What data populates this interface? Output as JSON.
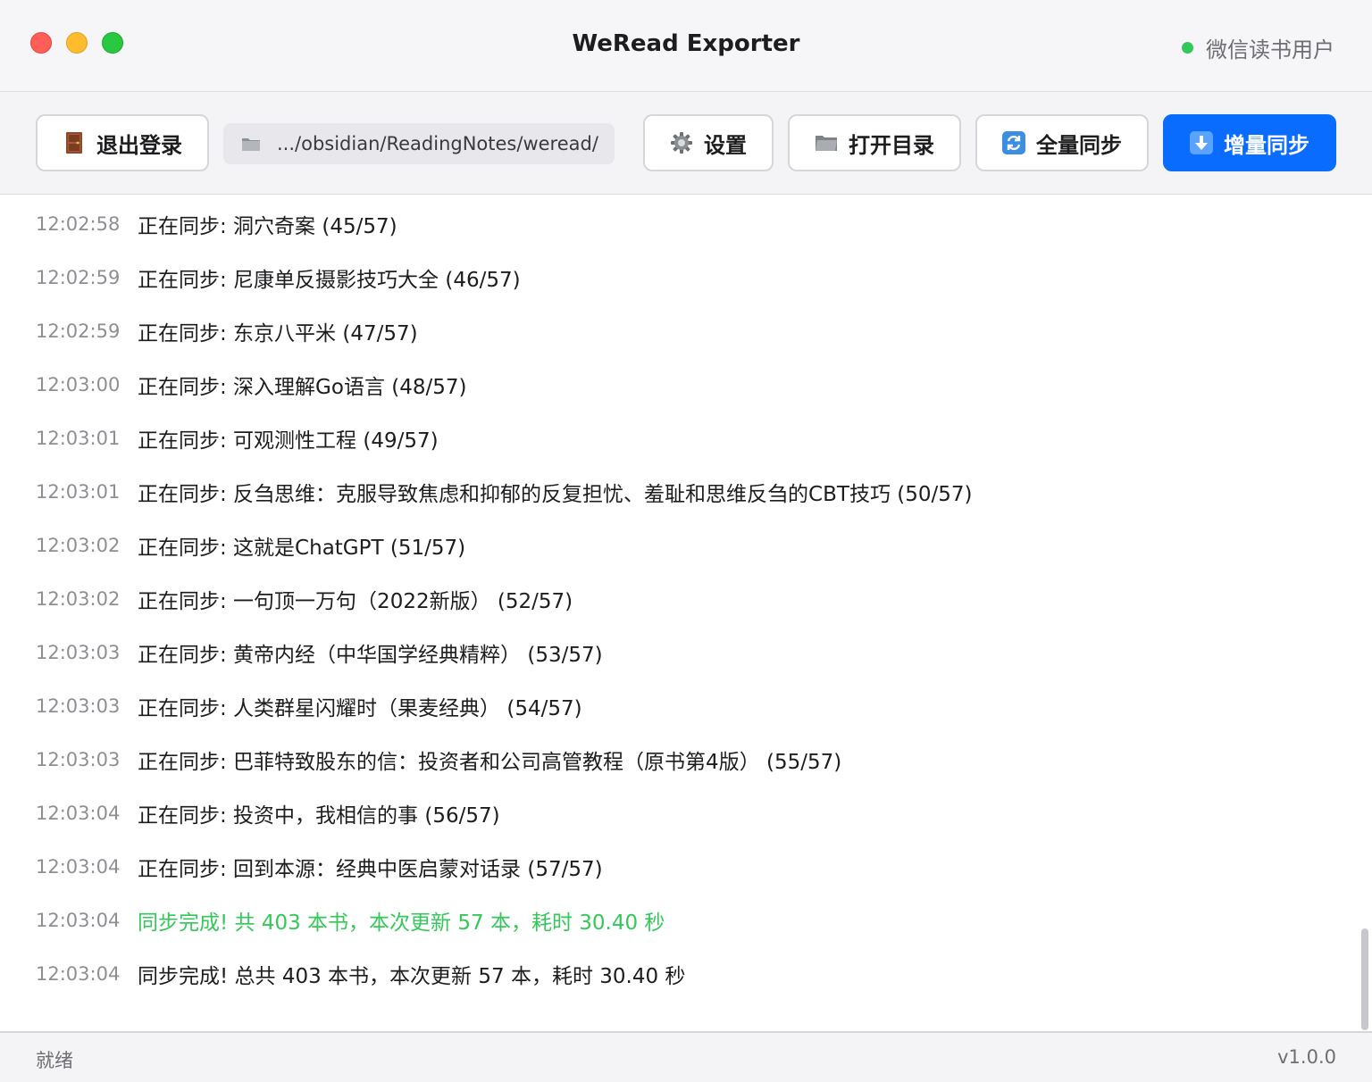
{
  "window": {
    "title": "WeRead Exporter",
    "user_label": "微信读书用户",
    "status_color": "#34c759"
  },
  "toolbar": {
    "logout_label": "退出登录",
    "logout_icon": "door-icon",
    "path_value": ".../obsidian/ReadingNotes/weread/",
    "path_icon": "folder-icon",
    "settings_label": "设置",
    "settings_icon": "gear-icon",
    "open_dir_label": "打开目录",
    "open_dir_icon": "folder-icon",
    "full_sync_label": "全量同步",
    "full_sync_icon": "refresh-icon",
    "incremental_sync_label": "增量同步",
    "incremental_sync_icon": "download-arrow-icon",
    "accent_color": "#0a6cff"
  },
  "log": {
    "entries": [
      {
        "time": "12:02:58",
        "message": "正在同步: 洞穴奇案 (45/57)",
        "type": "normal"
      },
      {
        "time": "12:02:59",
        "message": "正在同步: 尼康单反摄影技巧大全 (46/57)",
        "type": "normal"
      },
      {
        "time": "12:02:59",
        "message": "正在同步: 东京八平米 (47/57)",
        "type": "normal"
      },
      {
        "time": "12:03:00",
        "message": "正在同步: 深入理解Go语言 (48/57)",
        "type": "normal"
      },
      {
        "time": "12:03:01",
        "message": "正在同步: 可观测性工程 (49/57)",
        "type": "normal"
      },
      {
        "time": "12:03:01",
        "message": "正在同步: 反刍思维：克服导致焦虑和抑郁的反复担忧、羞耻和思维反刍的CBT技巧 (50/57)",
        "type": "normal"
      },
      {
        "time": "12:03:02",
        "message": "正在同步: 这就是ChatGPT (51/57)",
        "type": "normal"
      },
      {
        "time": "12:03:02",
        "message": "正在同步: 一句顶一万句（2022新版） (52/57)",
        "type": "normal"
      },
      {
        "time": "12:03:03",
        "message": "正在同步: 黄帝内经（中华国学经典精粹） (53/57)",
        "type": "normal"
      },
      {
        "time": "12:03:03",
        "message": "正在同步: 人类群星闪耀时（果麦经典） (54/57)",
        "type": "normal"
      },
      {
        "time": "12:03:03",
        "message": "正在同步: 巴菲特致股东的信：投资者和公司高管教程（原书第4版） (55/57)",
        "type": "normal"
      },
      {
        "time": "12:03:04",
        "message": "正在同步: 投资中，我相信的事 (56/57)",
        "type": "normal"
      },
      {
        "time": "12:03:04",
        "message": "正在同步: 回到本源：经典中医启蒙对话录 (57/57)",
        "type": "normal"
      },
      {
        "time": "12:03:04",
        "message": "同步完成! 共 403 本书，本次更新 57 本，耗时 30.40 秒",
        "type": "success"
      },
      {
        "time": "12:03:04",
        "message": "同步完成! 总共 403 本书，本次更新 57 本，耗时 30.40 秒",
        "type": "normal"
      }
    ],
    "success_color": "#34c759"
  },
  "statusbar": {
    "status_text": "就绪",
    "version": "v1.0.0"
  }
}
